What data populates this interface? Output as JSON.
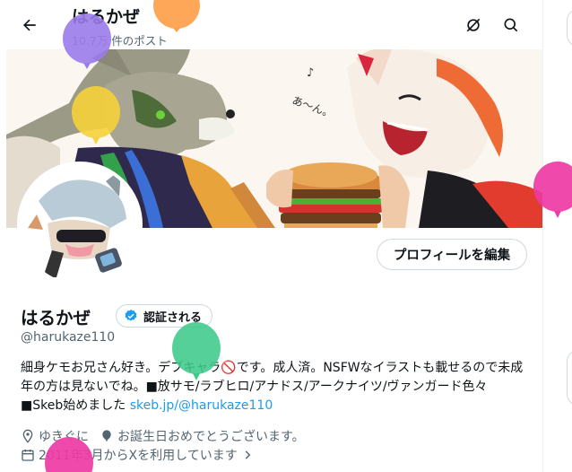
{
  "header": {
    "title": "はるかぜ",
    "post_count": "10.7万 件のポスト",
    "icons": [
      "back-arrow-icon",
      "hide-icon",
      "search-icon"
    ]
  },
  "profile": {
    "name": "はるかぜ",
    "verified_label": "認証される",
    "handle": "@harukaze110",
    "edit_label": "プロフィールを編集",
    "bio_text": "細身ケモお兄さん好き。デブキャラ🚫です。成人済。NSFWなイラストも載せるので未成年の方は見ないでね。■放サモ/ラブヒロ/アナドス/アークナイツ/ヴァンガード色々 ■Skeb始めました ",
    "bio_link": "skeb.jp/@harukaze110",
    "location": "ゆきぐに",
    "birthday": "お誕生日おめでとうございます。",
    "joined": "2011年3月からXを利用しています"
  },
  "banner": {
    "sound_text": "あ〜ん。"
  },
  "colors": {
    "accent": "#1d9bf0",
    "balloons": [
      "#9b7bea",
      "#ff9f4a",
      "#f6d13b",
      "#ee3aa5",
      "#3ec98a",
      "#ee3aa5"
    ]
  }
}
